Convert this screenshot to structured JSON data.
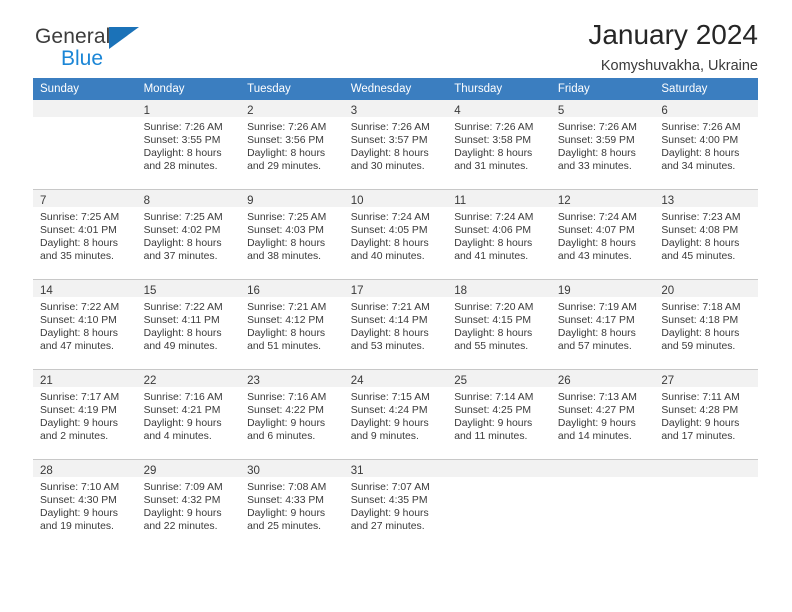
{
  "brand": {
    "name_part1": "General",
    "name_part2": "Blue",
    "triangle_color": "#1b72b8",
    "blue_color": "#1b86d6"
  },
  "header": {
    "title": "January 2024",
    "subtitle": "Komyshuvakha, Ukraine",
    "header_bg": "#3b7ec0",
    "daynum_bg": "#f2f2f2"
  },
  "weekday_headers": [
    "Sunday",
    "Monday",
    "Tuesday",
    "Wednesday",
    "Thursday",
    "Friday",
    "Saturday"
  ],
  "weeks": [
    [
      {
        "day": "",
        "sunrise": "",
        "sunset": "",
        "daylight1": "",
        "daylight2": ""
      },
      {
        "day": "1",
        "sunrise": "Sunrise: 7:26 AM",
        "sunset": "Sunset: 3:55 PM",
        "daylight1": "Daylight: 8 hours",
        "daylight2": "and 28 minutes."
      },
      {
        "day": "2",
        "sunrise": "Sunrise: 7:26 AM",
        "sunset": "Sunset: 3:56 PM",
        "daylight1": "Daylight: 8 hours",
        "daylight2": "and 29 minutes."
      },
      {
        "day": "3",
        "sunrise": "Sunrise: 7:26 AM",
        "sunset": "Sunset: 3:57 PM",
        "daylight1": "Daylight: 8 hours",
        "daylight2": "and 30 minutes."
      },
      {
        "day": "4",
        "sunrise": "Sunrise: 7:26 AM",
        "sunset": "Sunset: 3:58 PM",
        "daylight1": "Daylight: 8 hours",
        "daylight2": "and 31 minutes."
      },
      {
        "day": "5",
        "sunrise": "Sunrise: 7:26 AM",
        "sunset": "Sunset: 3:59 PM",
        "daylight1": "Daylight: 8 hours",
        "daylight2": "and 33 minutes."
      },
      {
        "day": "6",
        "sunrise": "Sunrise: 7:26 AM",
        "sunset": "Sunset: 4:00 PM",
        "daylight1": "Daylight: 8 hours",
        "daylight2": "and 34 minutes."
      }
    ],
    [
      {
        "day": "7",
        "sunrise": "Sunrise: 7:25 AM",
        "sunset": "Sunset: 4:01 PM",
        "daylight1": "Daylight: 8 hours",
        "daylight2": "and 35 minutes."
      },
      {
        "day": "8",
        "sunrise": "Sunrise: 7:25 AM",
        "sunset": "Sunset: 4:02 PM",
        "daylight1": "Daylight: 8 hours",
        "daylight2": "and 37 minutes."
      },
      {
        "day": "9",
        "sunrise": "Sunrise: 7:25 AM",
        "sunset": "Sunset: 4:03 PM",
        "daylight1": "Daylight: 8 hours",
        "daylight2": "and 38 minutes."
      },
      {
        "day": "10",
        "sunrise": "Sunrise: 7:24 AM",
        "sunset": "Sunset: 4:05 PM",
        "daylight1": "Daylight: 8 hours",
        "daylight2": "and 40 minutes."
      },
      {
        "day": "11",
        "sunrise": "Sunrise: 7:24 AM",
        "sunset": "Sunset: 4:06 PM",
        "daylight1": "Daylight: 8 hours",
        "daylight2": "and 41 minutes."
      },
      {
        "day": "12",
        "sunrise": "Sunrise: 7:24 AM",
        "sunset": "Sunset: 4:07 PM",
        "daylight1": "Daylight: 8 hours",
        "daylight2": "and 43 minutes."
      },
      {
        "day": "13",
        "sunrise": "Sunrise: 7:23 AM",
        "sunset": "Sunset: 4:08 PM",
        "daylight1": "Daylight: 8 hours",
        "daylight2": "and 45 minutes."
      }
    ],
    [
      {
        "day": "14",
        "sunrise": "Sunrise: 7:22 AM",
        "sunset": "Sunset: 4:10 PM",
        "daylight1": "Daylight: 8 hours",
        "daylight2": "and 47 minutes."
      },
      {
        "day": "15",
        "sunrise": "Sunrise: 7:22 AM",
        "sunset": "Sunset: 4:11 PM",
        "daylight1": "Daylight: 8 hours",
        "daylight2": "and 49 minutes."
      },
      {
        "day": "16",
        "sunrise": "Sunrise: 7:21 AM",
        "sunset": "Sunset: 4:12 PM",
        "daylight1": "Daylight: 8 hours",
        "daylight2": "and 51 minutes."
      },
      {
        "day": "17",
        "sunrise": "Sunrise: 7:21 AM",
        "sunset": "Sunset: 4:14 PM",
        "daylight1": "Daylight: 8 hours",
        "daylight2": "and 53 minutes."
      },
      {
        "day": "18",
        "sunrise": "Sunrise: 7:20 AM",
        "sunset": "Sunset: 4:15 PM",
        "daylight1": "Daylight: 8 hours",
        "daylight2": "and 55 minutes."
      },
      {
        "day": "19",
        "sunrise": "Sunrise: 7:19 AM",
        "sunset": "Sunset: 4:17 PM",
        "daylight1": "Daylight: 8 hours",
        "daylight2": "and 57 minutes."
      },
      {
        "day": "20",
        "sunrise": "Sunrise: 7:18 AM",
        "sunset": "Sunset: 4:18 PM",
        "daylight1": "Daylight: 8 hours",
        "daylight2": "and 59 minutes."
      }
    ],
    [
      {
        "day": "21",
        "sunrise": "Sunrise: 7:17 AM",
        "sunset": "Sunset: 4:19 PM",
        "daylight1": "Daylight: 9 hours",
        "daylight2": "and 2 minutes."
      },
      {
        "day": "22",
        "sunrise": "Sunrise: 7:16 AM",
        "sunset": "Sunset: 4:21 PM",
        "daylight1": "Daylight: 9 hours",
        "daylight2": "and 4 minutes."
      },
      {
        "day": "23",
        "sunrise": "Sunrise: 7:16 AM",
        "sunset": "Sunset: 4:22 PM",
        "daylight1": "Daylight: 9 hours",
        "daylight2": "and 6 minutes."
      },
      {
        "day": "24",
        "sunrise": "Sunrise: 7:15 AM",
        "sunset": "Sunset: 4:24 PM",
        "daylight1": "Daylight: 9 hours",
        "daylight2": "and 9 minutes."
      },
      {
        "day": "25",
        "sunrise": "Sunrise: 7:14 AM",
        "sunset": "Sunset: 4:25 PM",
        "daylight1": "Daylight: 9 hours",
        "daylight2": "and 11 minutes."
      },
      {
        "day": "26",
        "sunrise": "Sunrise: 7:13 AM",
        "sunset": "Sunset: 4:27 PM",
        "daylight1": "Daylight: 9 hours",
        "daylight2": "and 14 minutes."
      },
      {
        "day": "27",
        "sunrise": "Sunrise: 7:11 AM",
        "sunset": "Sunset: 4:28 PM",
        "daylight1": "Daylight: 9 hours",
        "daylight2": "and 17 minutes."
      }
    ],
    [
      {
        "day": "28",
        "sunrise": "Sunrise: 7:10 AM",
        "sunset": "Sunset: 4:30 PM",
        "daylight1": "Daylight: 9 hours",
        "daylight2": "and 19 minutes."
      },
      {
        "day": "29",
        "sunrise": "Sunrise: 7:09 AM",
        "sunset": "Sunset: 4:32 PM",
        "daylight1": "Daylight: 9 hours",
        "daylight2": "and 22 minutes."
      },
      {
        "day": "30",
        "sunrise": "Sunrise: 7:08 AM",
        "sunset": "Sunset: 4:33 PM",
        "daylight1": "Daylight: 9 hours",
        "daylight2": "and 25 minutes."
      },
      {
        "day": "31",
        "sunrise": "Sunrise: 7:07 AM",
        "sunset": "Sunset: 4:35 PM",
        "daylight1": "Daylight: 9 hours",
        "daylight2": "and 27 minutes."
      },
      {
        "day": "",
        "sunrise": "",
        "sunset": "",
        "daylight1": "",
        "daylight2": ""
      },
      {
        "day": "",
        "sunrise": "",
        "sunset": "",
        "daylight1": "",
        "daylight2": ""
      },
      {
        "day": "",
        "sunrise": "",
        "sunset": "",
        "daylight1": "",
        "daylight2": ""
      }
    ]
  ]
}
